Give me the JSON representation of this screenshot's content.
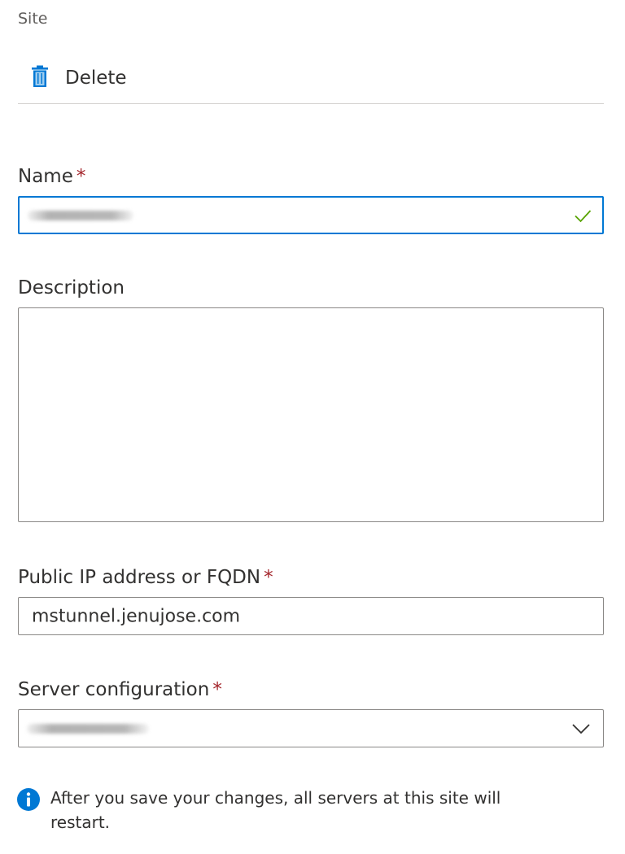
{
  "panel": {
    "title": "Site"
  },
  "toolbar": {
    "delete_label": "Delete",
    "delete_icon": "trash-icon"
  },
  "fields": {
    "name": {
      "label": "Name",
      "required": "*",
      "value_redacted": true,
      "status_icon": "checkmark-icon"
    },
    "description": {
      "label": "Description",
      "value": ""
    },
    "public_ip": {
      "label": "Public IP address or FQDN",
      "required": "*",
      "value": "mstunnel.jenujose.com"
    },
    "server_configuration": {
      "label": "Server configuration",
      "required": "*",
      "value_redacted": true,
      "dropdown_icon": "chevron-down-icon"
    }
  },
  "info": {
    "icon": "info-icon",
    "message": "After you save your changes, all servers at this site will restart."
  },
  "colors": {
    "accent": "#0078d4",
    "required": "#a4262c",
    "success": "#57a300",
    "info_icon": "#0078d4",
    "text": "#323130"
  }
}
